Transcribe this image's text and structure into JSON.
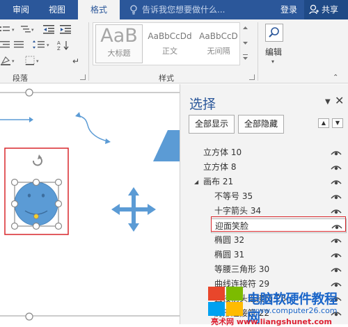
{
  "tabs": [
    {
      "label": "审阅"
    },
    {
      "label": "视图"
    },
    {
      "label": "格式",
      "active": true
    }
  ],
  "tell_me": {
    "placeholder": "告诉我您想要做什么..."
  },
  "account": {
    "login_label": "登录",
    "share_label": "共享"
  },
  "ribbon": {
    "paragraph_group_label": "段落",
    "styles_group_label": "样式",
    "styles": [
      {
        "sample": "AaB",
        "name": "大标题"
      },
      {
        "sample": "AaBbCcDd",
        "name": "正文"
      },
      {
        "sample": "AaBbCcD",
        "name": "无间隔"
      }
    ],
    "edit_label": "编辑"
  },
  "selection_pane": {
    "title": "选择",
    "show_all_label": "全部显示",
    "hide_all_label": "全部隐藏",
    "items": [
      {
        "label": "立方体 10",
        "level": 0
      },
      {
        "label": "立方体 8",
        "level": 0
      },
      {
        "label": "画布 21",
        "level": 0,
        "expanded": true
      },
      {
        "label": "不等号 35",
        "level": 1
      },
      {
        "label": "十字箭头 34",
        "level": 1
      },
      {
        "label": "迎面笑脸",
        "level": 1,
        "selected": true
      },
      {
        "label": "椭圆 32",
        "level": 1
      },
      {
        "label": "椭圆 31",
        "level": 1
      },
      {
        "label": "等腰三角形 30",
        "level": 1
      },
      {
        "label": "曲线连接符 29",
        "level": 1
      },
      {
        "label": "直接箭头连接符 28",
        "level": 1
      },
      {
        "label": "肘形连接符 22",
        "level": 1
      }
    ]
  },
  "watermark": {
    "title": "电脑软硬件教程网",
    "url": "www.computer26.com",
    "url2": "亮术网 www.liangshunet.com"
  },
  "colors": {
    "accent": "#2b579a",
    "highlight": "#d8262b",
    "shape_fill": "#5b9bd5"
  }
}
